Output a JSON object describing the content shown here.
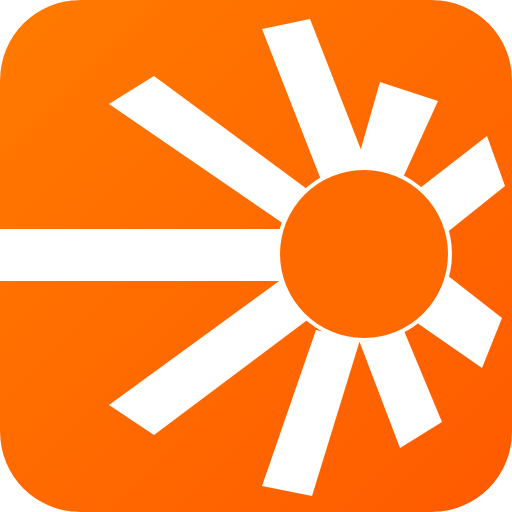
{
  "icon": {
    "name": "sunburst-logo-icon",
    "gradient_start": "#FF7A00",
    "gradient_end": "#FF5A00",
    "mark_color": "#FFFFFF",
    "sun_color": "#FF6A00"
  }
}
